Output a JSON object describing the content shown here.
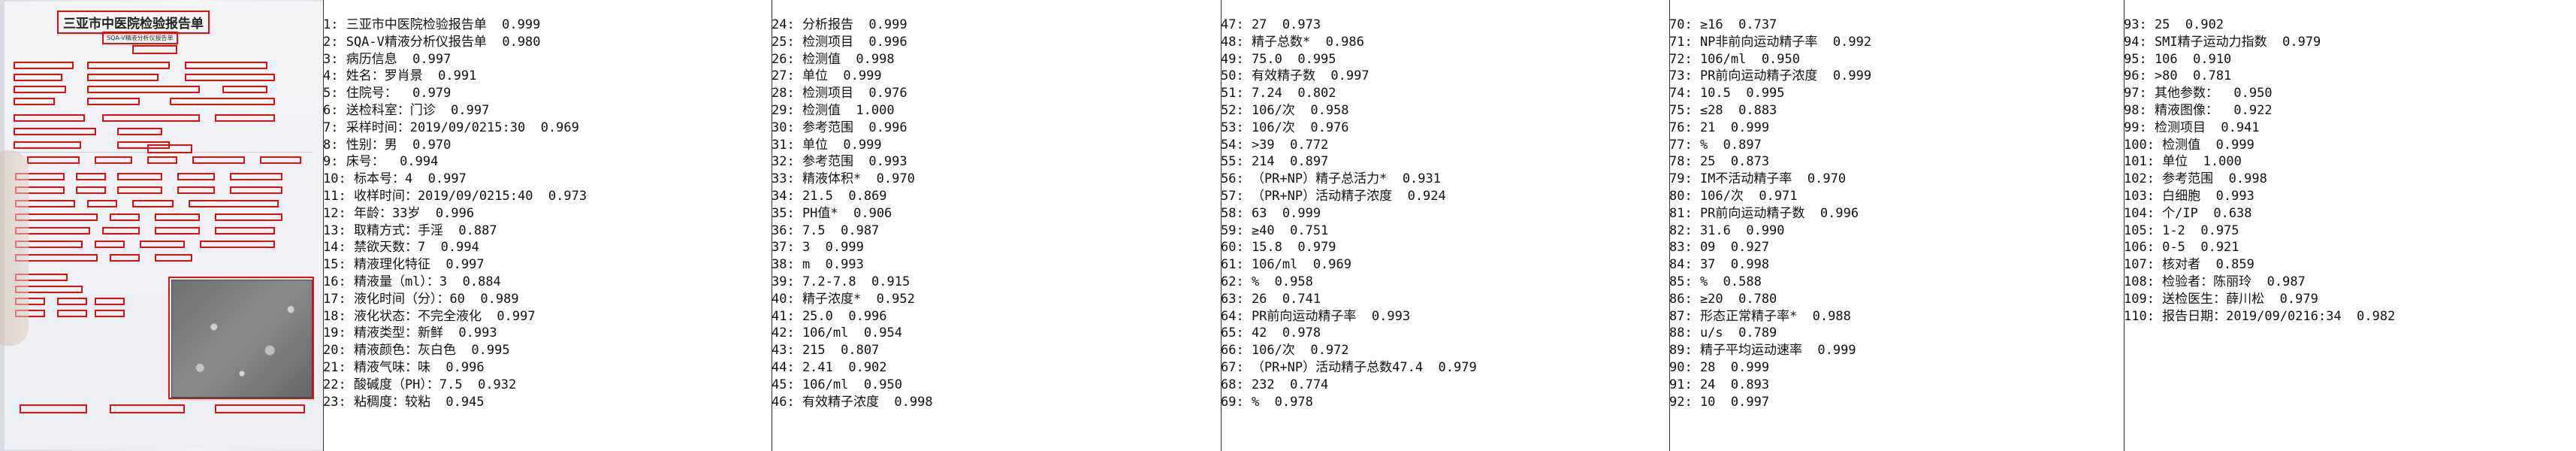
{
  "photo": {
    "title": "三亚市中医院检验报告单",
    "subtitle": "SQA-V精液分析仪报告单"
  },
  "columns": [
    [
      "1: 三亚市中医院检验报告单  0.999",
      "2: SQA-V精液分析仪报告单  0.980",
      "3: 病历信息  0.997",
      "4: 姓名：罗肖景  0.991",
      "5: 住院号：  0.979",
      "6: 送检科室：门诊  0.997",
      "7: 采样时间：2019/09/0215:30  0.969",
      "8: 性别：男  0.970",
      "9: 床号：  0.994",
      "10: 标本号：4  0.997",
      "11: 收样时间：2019/09/0215:40  0.973",
      "12: 年龄：33岁  0.996",
      "13: 取精方式：手淫  0.887",
      "14: 禁欲天数：7  0.994",
      "15: 精液理化特征  0.997",
      "16: 精液量（ml）：3  0.884",
      "17: 液化时间（分）：60  0.989",
      "18: 液化状态：不完全液化  0.997",
      "19: 精液类型：新鲜  0.993",
      "20: 精液颜色：灰白色  0.995",
      "21: 精液气味：味  0.996",
      "22: 酸碱度（PH）：7.5  0.932",
      "23: 粘稠度：较粘  0.945"
    ],
    [
      "24: 分析报告  0.999",
      "25: 检测项目  0.996",
      "26: 检测值  0.998",
      "27: 单位  0.999",
      "28: 检测项目  0.976",
      "29: 检测值  1.000",
      "30: 参考范围  0.996",
      "31: 单位  0.999",
      "32: 参考范围  0.993",
      "33: 精液体积*  0.970",
      "34: 21.5  0.869",
      "35: PH值*  0.906",
      "36: 7.5  0.987",
      "37: 3  0.999",
      "38: m  0.993",
      "39: 7.2-7.8  0.915",
      "40: 精子浓度*  0.952",
      "41: 25.0  0.996",
      "42: 106/ml  0.954",
      "43: 215  0.807",
      "44: 2.41  0.902",
      "45: 106/ml  0.950",
      "46: 有效精子浓度  0.998"
    ],
    [
      "47: 27  0.973",
      "48: 精子总数*  0.986",
      "49: 75.0  0.995",
      "50: 有效精子数  0.997",
      "51: 7.24  0.802",
      "52: 106/次  0.958",
      "53: 106/次  0.976",
      "54: >39  0.772",
      "55: 214  0.897",
      "56: （PR+NP）精子总活力*  0.931",
      "57: （PR+NP）活动精子浓度  0.924",
      "58: 63  0.999",
      "59: ≥40  0.751",
      "60: 15.8  0.979",
      "61: 106/ml  0.969",
      "62: %  0.958",
      "63: 26  0.741",
      "64: PR前向运动精子率  0.993",
      "65: 42  0.978",
      "66: 106/次  0.972",
      "67: （PR+NP）活动精子总数47.4  0.979",
      "68: 232  0.774",
      "69: %  0.978"
    ],
    [
      "70: ≥16  0.737",
      "71: NP非前向运动精子率  0.992",
      "72: 106/ml  0.950",
      "73: PR前向运动精子浓度  0.999",
      "74: 10.5  0.995",
      "75: ≤28  0.883",
      "76: 21  0.999",
      "77: %  0.897",
      "78: 25  0.873",
      "79: IM不活动精子率  0.970",
      "80: 106/次  0.971",
      "81: PR前向运动精子数  0.996",
      "82: 31.6  0.990",
      "83: 09  0.927",
      "84: 37  0.998",
      "85: %  0.588",
      "86: ≥20  0.780",
      "87: 形态正常精子率*  0.988",
      "88: u/s  0.789",
      "89: 精子平均运动速率  0.999",
      "90: 28  0.999",
      "91: 24  0.893",
      "92: 10  0.997"
    ],
    [
      "93: 25  0.902",
      "94: SMI精子运动力指数  0.979",
      "95: 106  0.910",
      "96: >80  0.781",
      "97: 其他参数：  0.950",
      "98: 精液图像：  0.922",
      "99: 检测项目  0.941",
      "100: 检测值  0.999",
      "101: 单位  1.000",
      "102: 参考范围  0.998",
      "103: 白细胞  0.993",
      "104: 个/IP  0.638",
      "105: 1-2  0.975",
      "106: 0-5  0.921",
      "107: 核对者  0.859",
      "108: 检验者：陈丽玲  0.987",
      "109: 送检医生：薛川松  0.979",
      "110: 报告日期：2019/09/0216:34  0.982"
    ]
  ]
}
